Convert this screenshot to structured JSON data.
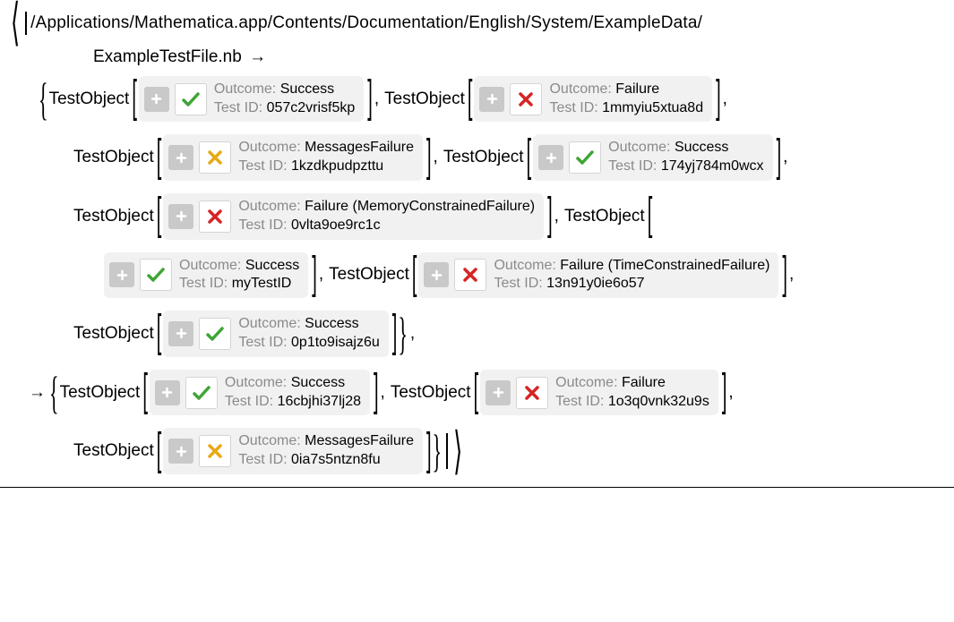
{
  "assoc_open": "〈",
  "assoc_close": "〉",
  "path": "/Applications/Mathematica.app/Contents/Documentation/English/System/ExampleData/",
  "file_name": "ExampleTestFile.nb",
  "arrow": "→",
  "labels": {
    "testobject": "TestObject",
    "outcome": "Outcome:",
    "testid": "Test ID:"
  },
  "tests_a": [
    {
      "status": "success",
      "outcome": "Success",
      "testid": "057c2vrisf5kp"
    },
    {
      "status": "failure",
      "outcome": "Failure",
      "testid": "1mmyiu5xtua8d"
    },
    {
      "status": "warn",
      "outcome": "MessagesFailure",
      "testid": "1kzdkpudpzttu"
    },
    {
      "status": "success",
      "outcome": "Success",
      "testid": "174yj784m0wcx"
    },
    {
      "status": "failure",
      "outcome": "Failure (MemoryConstrainedFailure)",
      "testid": "0vlta9oe9rc1c"
    },
    {
      "status": "success",
      "outcome": "Success",
      "testid": "myTestID"
    },
    {
      "status": "failure",
      "outcome": "Failure (TimeConstrainedFailure)",
      "testid": "13n91y0ie6o57"
    },
    {
      "status": "success",
      "outcome": "Success",
      "testid": "0p1to9isajz6u"
    }
  ],
  "tests_b": [
    {
      "status": "success",
      "outcome": "Success",
      "testid": "16cbjhi37lj28"
    },
    {
      "status": "failure",
      "outcome": "Failure",
      "testid": "1o3q0vnk32u9s"
    },
    {
      "status": "warn",
      "outcome": "MessagesFailure",
      "testid": "0ia7s5ntzn8fu"
    }
  ]
}
